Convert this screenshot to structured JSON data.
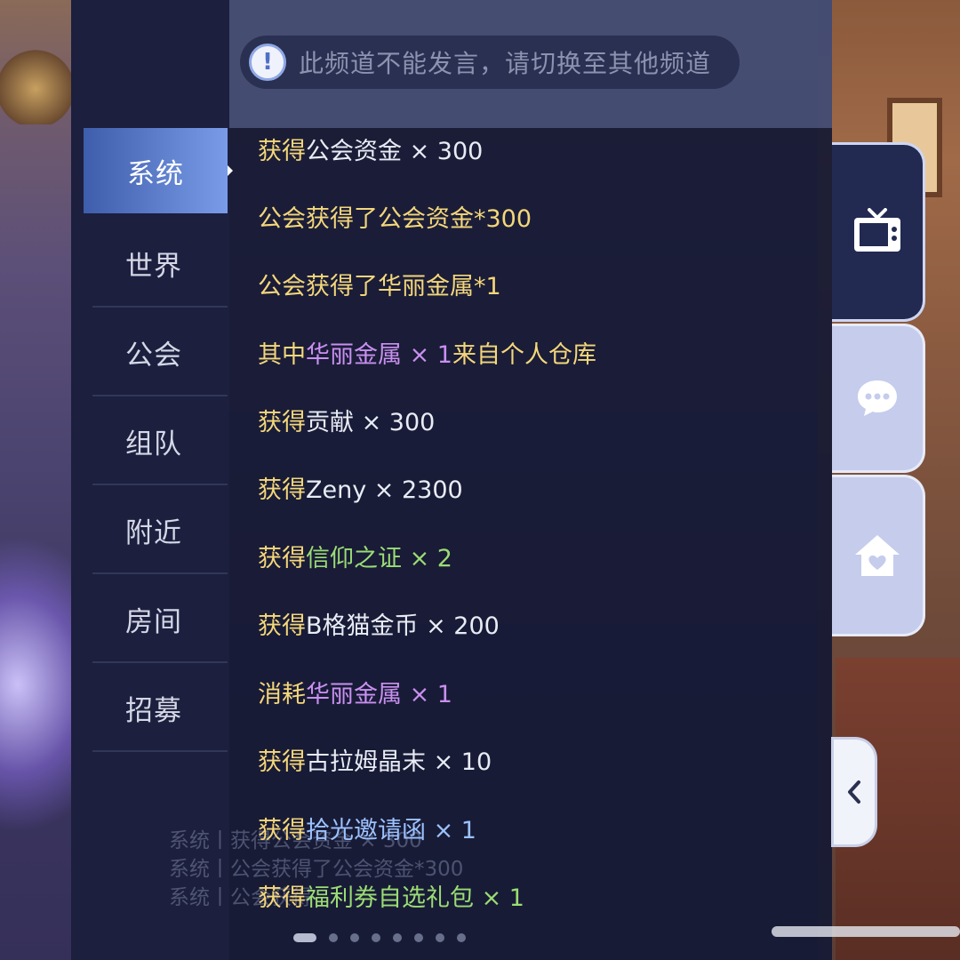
{
  "notice": {
    "text": "此频道不能发言，请切换至其他频道"
  },
  "channels": [
    {
      "label": "系统"
    },
    {
      "label": "世界"
    },
    {
      "label": "公会"
    },
    {
      "label": "组队"
    },
    {
      "label": "附近"
    },
    {
      "label": "房间"
    },
    {
      "label": "招募"
    }
  ],
  "messages": [
    {
      "parts": [
        "获得",
        "公会资金",
        " × 300"
      ]
    },
    {
      "parts": [
        "公会获得了公会资金*300"
      ]
    },
    {
      "parts": [
        "公会获得了华丽金属*1"
      ]
    },
    {
      "parts": [
        "其中",
        "华丽金属 × 1",
        "来自个人仓库"
      ]
    },
    {
      "parts": [
        "获得",
        "贡献 × 300"
      ]
    },
    {
      "parts": [
        "获得",
        "Zeny × 2300"
      ]
    },
    {
      "parts": [
        "获得",
        "信仰之证 × 2"
      ]
    },
    {
      "parts": [
        "获得",
        "B格猫金币 × 200"
      ]
    },
    {
      "parts": [
        "消耗",
        "华丽金属 × 1"
      ]
    },
    {
      "parts": [
        "获得",
        "古拉姆晶末 × 10"
      ]
    },
    {
      "parts": [
        "获得",
        "拾光邀请函 × 1"
      ]
    },
    {
      "parts": [
        "获得",
        "福利券自选礼包 × 1"
      ]
    }
  ],
  "background_chat": [
    "系统丨获得公会资金 × 300",
    "系统丨公会获得了公会资金*300",
    "系统丨公会获得"
  ],
  "icons": {
    "tab_active": "tv-icon",
    "tab_chat": "chat-bubble-icon",
    "tab_home": "home-heart-icon",
    "collapse": "chevron-left-icon"
  },
  "colors": {
    "yellow": "#f4d77a",
    "white": "#e8ecf4",
    "purple": "#c990ef",
    "green": "#9bdc74",
    "blue": "#9cc2ff",
    "active_channel": "#5b7ccc"
  }
}
